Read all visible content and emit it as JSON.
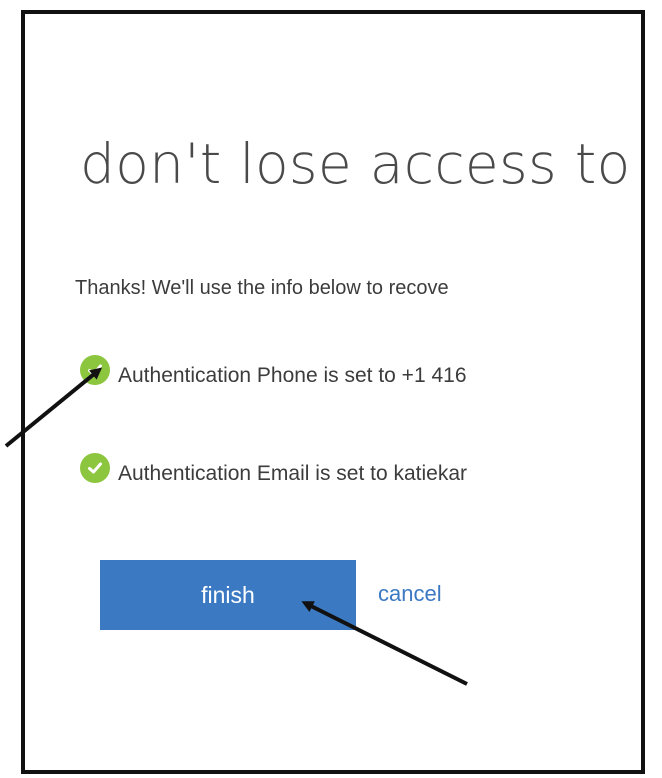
{
  "header": {
    "title": "don't lose access to"
  },
  "main": {
    "intro_text": "Thanks! We'll use the info below to recove",
    "status_items": [
      {
        "icon": "check-circle-icon",
        "text": "Authentication Phone is set to +1 416"
      },
      {
        "icon": "check-circle-icon",
        "text": "Authentication Email is set to katiekar"
      }
    ]
  },
  "actions": {
    "finish_label": "finish",
    "cancel_label": "cancel"
  },
  "colors": {
    "accent": "#3c79c3",
    "check": "#8cc63e",
    "text": "#3c3c3c",
    "frame": "#111111"
  }
}
